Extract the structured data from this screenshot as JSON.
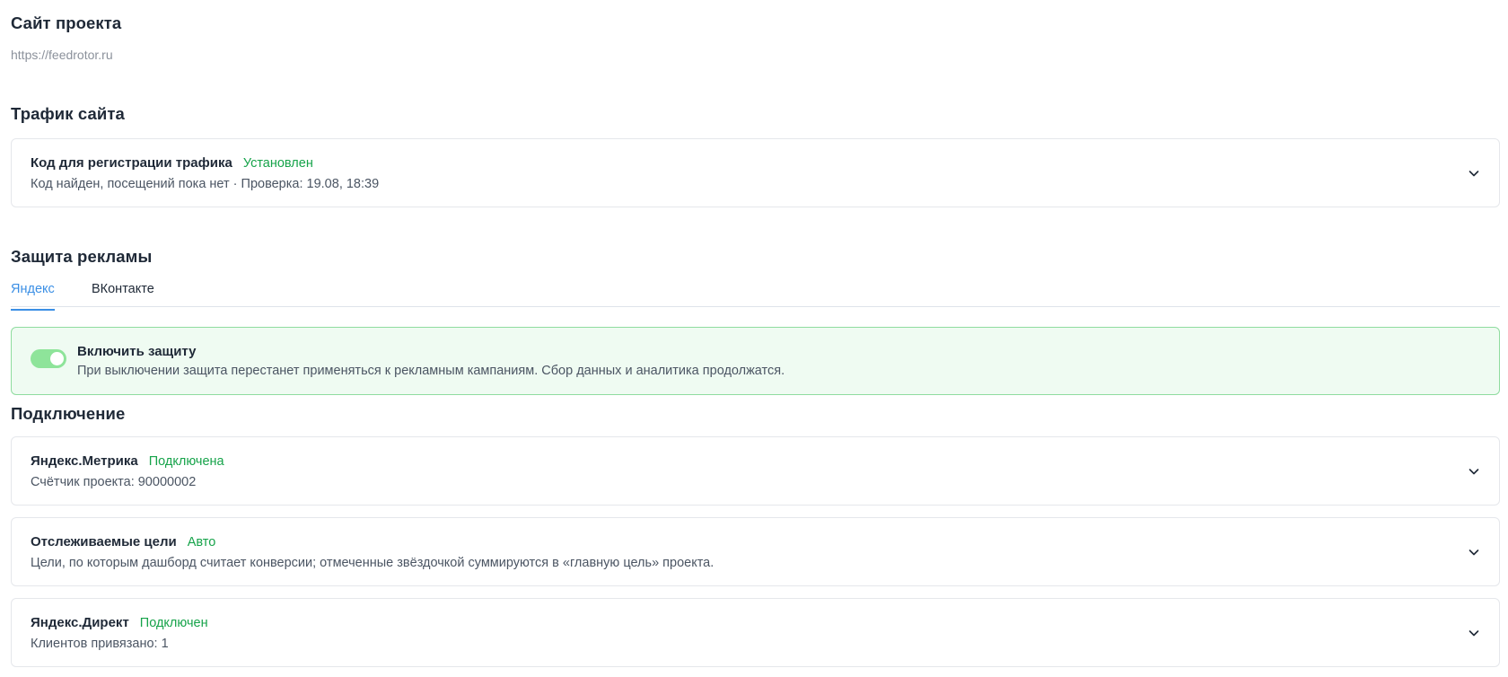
{
  "site": {
    "heading": "Сайт проекта",
    "url": "https://feedrotor.ru"
  },
  "traffic": {
    "heading": "Трафик сайта",
    "card": {
      "title": "Код для регистрации трафика",
      "status": "Установлен",
      "subtitle": "Код найден, посещений пока нет · Проверка: 19.08, 18:39"
    }
  },
  "ad_protection": {
    "heading": "Защита рекламы",
    "tabs": [
      {
        "label": "Яндекс",
        "active": true
      },
      {
        "label": "ВКонтакте",
        "active": false
      }
    ],
    "toggle": {
      "enabled": true,
      "title": "Включить защиту",
      "description": "При выключении защита перестанет применяться к рекламным кампаниям. Сбор данных и аналитика продолжатся."
    }
  },
  "connection": {
    "heading": "Подключение",
    "cards": [
      {
        "title": "Яндекс.Метрика",
        "status": "Подключена",
        "subtitle": "Счётчик проекта: 90000002"
      },
      {
        "title": "Отслеживаемые цели",
        "status": "Авто",
        "subtitle": "Цели, по которым дашборд считает конверсии; отмеченные звёздочкой суммируются в «главную цель» проекта."
      },
      {
        "title": "Яндекс.Директ",
        "status": "Подключен",
        "subtitle": "Клиентов привязано: 1"
      }
    ]
  },
  "colors": {
    "status_green": "#16a34a",
    "tab_active": "#3b8fe5",
    "protect_bg": "#effbf2",
    "protect_border": "#8fdc9f",
    "toggle_on": "#8ee49a"
  },
  "icons": {
    "expand": "chevron-down-icon"
  }
}
